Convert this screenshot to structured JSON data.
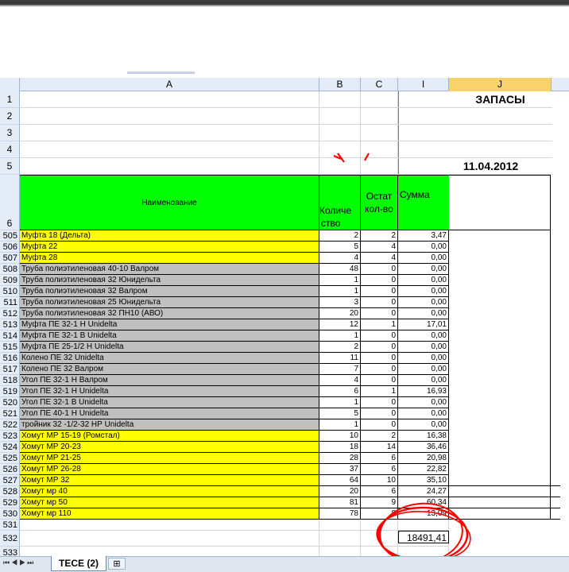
{
  "columns": [
    "A",
    "B",
    "C",
    "I",
    "J"
  ],
  "header_row_numbers": [
    "1",
    "2",
    "3",
    "4",
    "5",
    "6"
  ],
  "title": "ЗАПАСЫ",
  "date": "11.04.2012",
  "headers": {
    "name": "Наименование",
    "qty_l1": "Количе",
    "qty_l2": "ство",
    "rest_l1": "Остат",
    "rest_l2": "кол-во",
    "sum": "Сумма"
  },
  "rows": [
    {
      "n": "505",
      "name": "Муфта 18 (Дельта)",
      "b": "2",
      "c": "2",
      "i": "3,47",
      "color": "yellow"
    },
    {
      "n": "506",
      "name": "Муфта 22",
      "b": "5",
      "c": "4",
      "i": "0,00",
      "color": "yellow"
    },
    {
      "n": "507",
      "name": "Муфта 28",
      "b": "4",
      "c": "4",
      "i": "0,00",
      "color": "yellow"
    },
    {
      "n": "508",
      "name": "Труба полиэтиленовая 40-10 Валром",
      "b": "48",
      "c": "0",
      "i": "0,00",
      "color": "gray"
    },
    {
      "n": "509",
      "name": "Труба полиэтиленовая 32 Юнидельта",
      "b": "1",
      "c": "0",
      "i": "0,00",
      "color": "gray"
    },
    {
      "n": "510",
      "name": "Труба полиэтиленовая 32 Валром",
      "b": "1",
      "c": "0",
      "i": "0,00",
      "color": "gray"
    },
    {
      "n": "511",
      "name": "Труба полиэтиленовая 25 Юнидельта",
      "b": "3",
      "c": "0",
      "i": "0,00",
      "color": "gray"
    },
    {
      "n": "512",
      "name": "Труба полиэтиленовая 32 ПН10 (АВО)",
      "b": "20",
      "c": "0",
      "i": "0,00",
      "color": "gray"
    },
    {
      "n": "513",
      "name": "Муфта ПЕ 32-1 Н Unidelta",
      "b": "12",
      "c": "1",
      "i": "17,01",
      "color": "gray"
    },
    {
      "n": "514",
      "name": "Муфта ПЕ 32-1 В Unidelta",
      "b": "1",
      "c": "0",
      "i": "0,00",
      "color": "gray"
    },
    {
      "n": "515",
      "name": "Муфта ПЕ 25-1/2 Н Unidelta",
      "b": "2",
      "c": "0",
      "i": "0,00",
      "color": "gray"
    },
    {
      "n": "516",
      "name": "Колено ПЕ 32 Unidelta",
      "b": "11",
      "c": "0",
      "i": "0,00",
      "color": "gray"
    },
    {
      "n": "517",
      "name": "Колено ПЕ 32 Валром",
      "b": "7",
      "c": "0",
      "i": "0,00",
      "color": "gray"
    },
    {
      "n": "518",
      "name": "Угол ПЕ 32-1 Н Валром",
      "b": "4",
      "c": "0",
      "i": "0,00",
      "color": "gray"
    },
    {
      "n": "519",
      "name": "Угол ПЕ 32-1 Н Unidelta",
      "b": "6",
      "c": "1",
      "i": "16,93",
      "color": "gray"
    },
    {
      "n": "520",
      "name": "Угол ПЕ 32-1 В Unidelta",
      "b": "1",
      "c": "0",
      "i": "0,00",
      "color": "gray"
    },
    {
      "n": "521",
      "name": "Угол ПЕ 40-1 Н Unidelta",
      "b": "5",
      "c": "0",
      "i": "0,00",
      "color": "gray"
    },
    {
      "n": "522",
      "name": "тройник 32 -1/2-32 НР Unidelta",
      "b": "1",
      "c": "0",
      "i": "0,00",
      "color": "gray"
    },
    {
      "n": "523",
      "name": "Хомут МР 15-19 (Ромстал)",
      "b": "10",
      "c": "2",
      "i": "16,38",
      "color": "yellow"
    },
    {
      "n": "524",
      "name": "Хомут МР 20-23",
      "b": "18",
      "c": "14",
      "i": "36,46",
      "color": "yellow"
    },
    {
      "n": "525",
      "name": "Хомут МР 21-25",
      "b": "28",
      "c": "6",
      "i": "20,98",
      "color": "yellow"
    },
    {
      "n": "526",
      "name": "Хомут МР 26-28",
      "b": "37",
      "c": "6",
      "i": "22,82",
      "color": "yellow"
    },
    {
      "n": "527",
      "name": "Хомут МР 32",
      "b": "64",
      "c": "10",
      "i": "35,10",
      "color": "yellow"
    },
    {
      "n": "528",
      "name": "Хомут мр 40",
      "b": "20",
      "c": "6",
      "i": "24,27",
      "color": "yellow"
    },
    {
      "n": "529",
      "name": "Хомут мр 50",
      "b": "81",
      "c": "9",
      "i": "60,34",
      "color": "yellow"
    },
    {
      "n": "530",
      "name": "Хомут мр 110",
      "b": "78",
      "c": "8",
      "i": "13,09",
      "color": "yellow"
    }
  ],
  "tail_rows": [
    "531",
    "532",
    "533"
  ],
  "total": "18491,41",
  "sheet_tab": "ТЕСЕ (2)",
  "colors": {
    "yellow": "#ffff00",
    "gray": "#c0c0c0",
    "green": "#00ff00",
    "header_bg": "#e4ecf7",
    "annotation": "#ff0000"
  }
}
